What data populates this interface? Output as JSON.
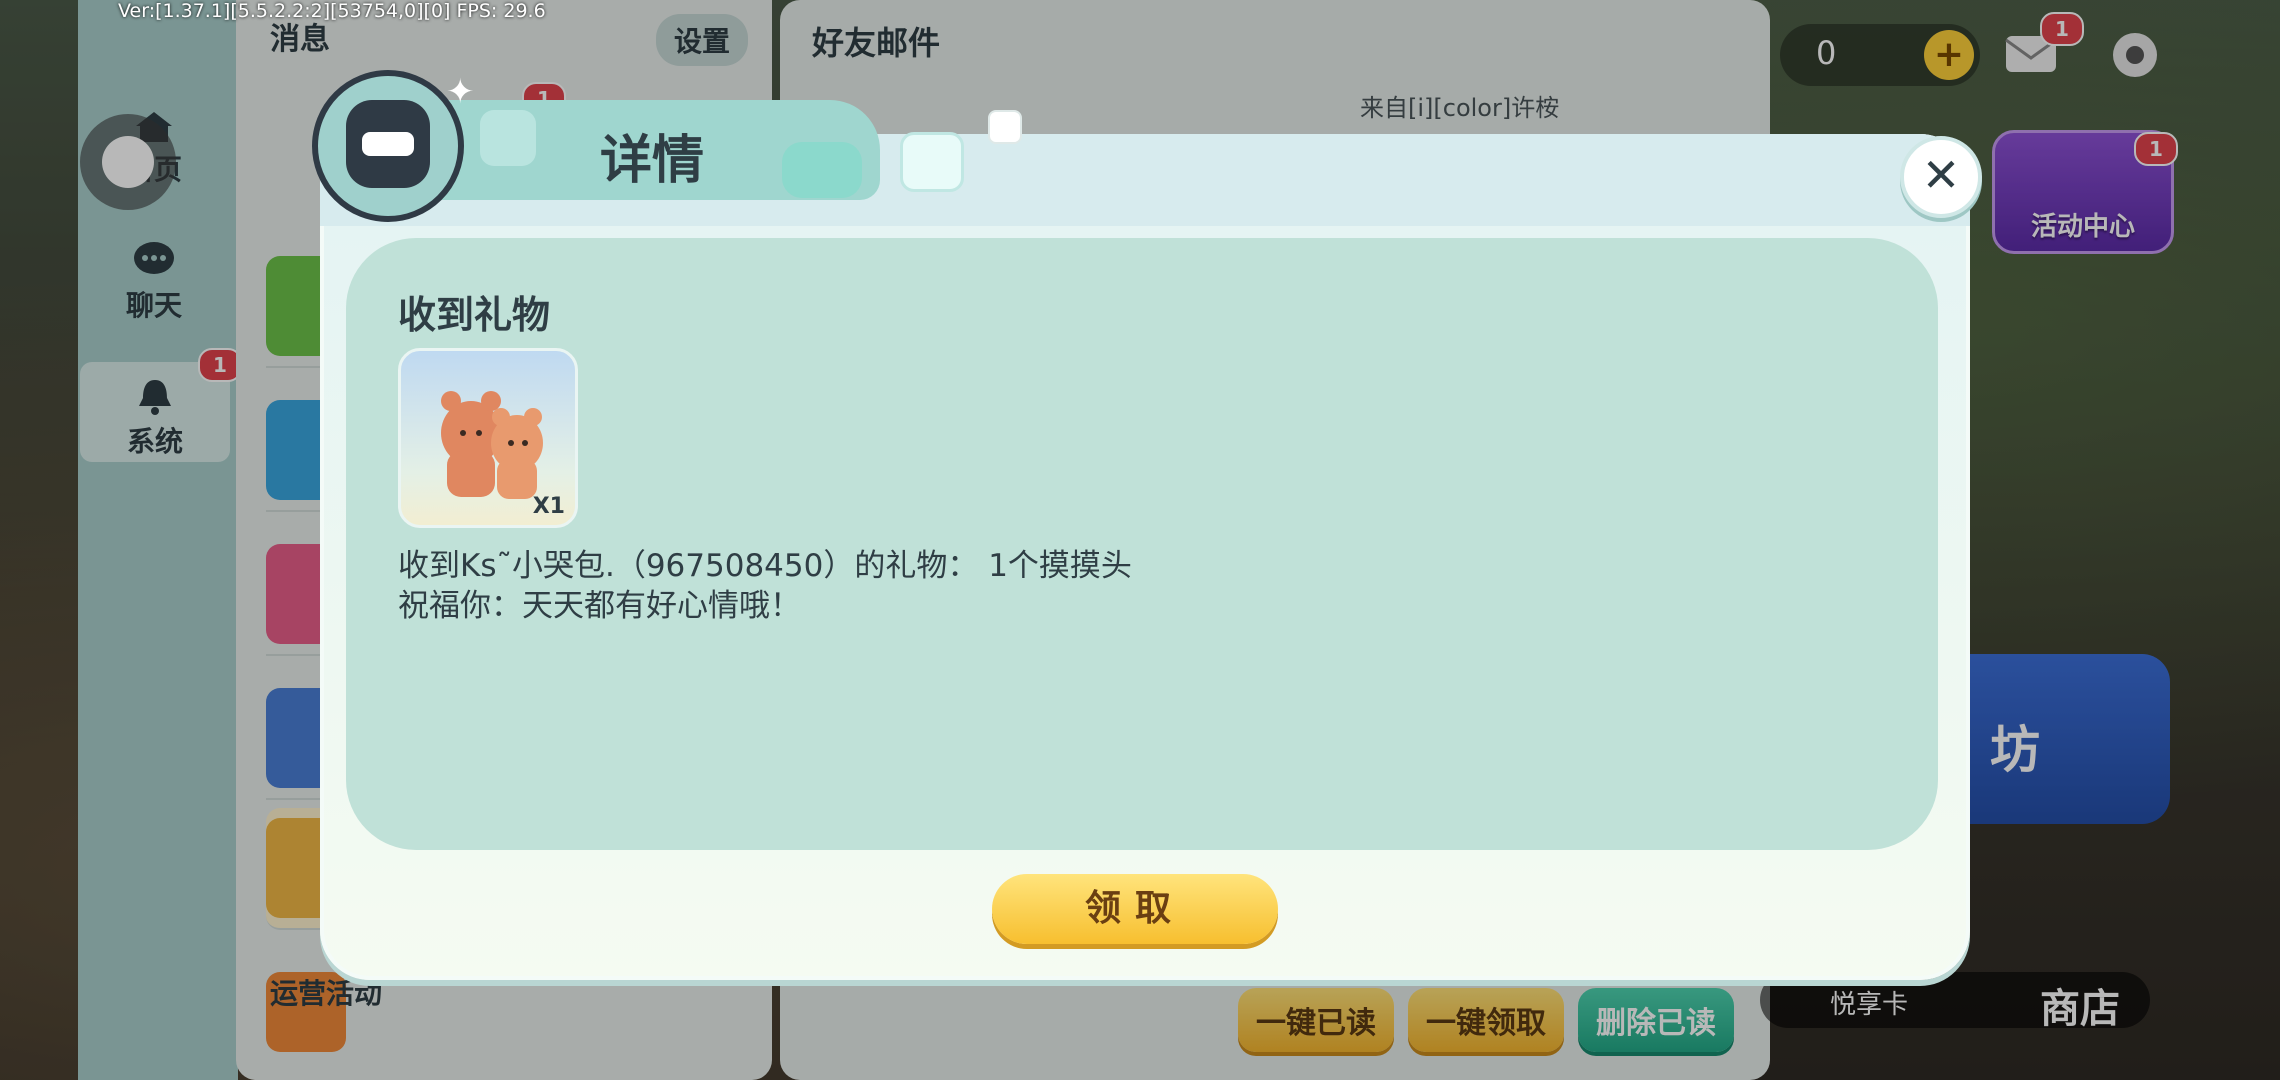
{
  "debug": {
    "text": "Ver:[1.37.1][5.5.2.2:2][53754,0][0] FPS: 29.6"
  },
  "leftnav": {
    "items": [
      {
        "label": "首页"
      },
      {
        "label": "聊天"
      },
      {
        "label": "系统",
        "badge": "1"
      }
    ]
  },
  "messages": {
    "title": "消息",
    "settings": "设置",
    "tab_badge": "1",
    "last_item": "运营活动"
  },
  "mail": {
    "title": "好友邮件",
    "from": "来自[i][color]许桉",
    "buttons": {
      "read_all": "一键已读",
      "claim_all": "一键领取",
      "delete_read": "删除已读"
    }
  },
  "hud": {
    "coins": "0",
    "mail_badge": "1",
    "activity_label": "活动中心",
    "activity_badge": "1",
    "craft_label": "坊",
    "vip_label": "悦享卡",
    "shop_label": "商店"
  },
  "modal": {
    "title": "详情",
    "heading": "收到礼物",
    "gift_qty": "X1",
    "line1": "收到Ks˜小哭包.（967508450）的礼物： 1个摸摸头",
    "line2": "祝福你：天天都有好心情哦！",
    "claim": "领取"
  },
  "colors": {
    "panel_bg": "#e9efec",
    "nav_bg": "#a9cfcc",
    "content_bg": "#c0e1d8",
    "claim_gold": "#f7bf2f",
    "badge_red": "#e2434d"
  }
}
